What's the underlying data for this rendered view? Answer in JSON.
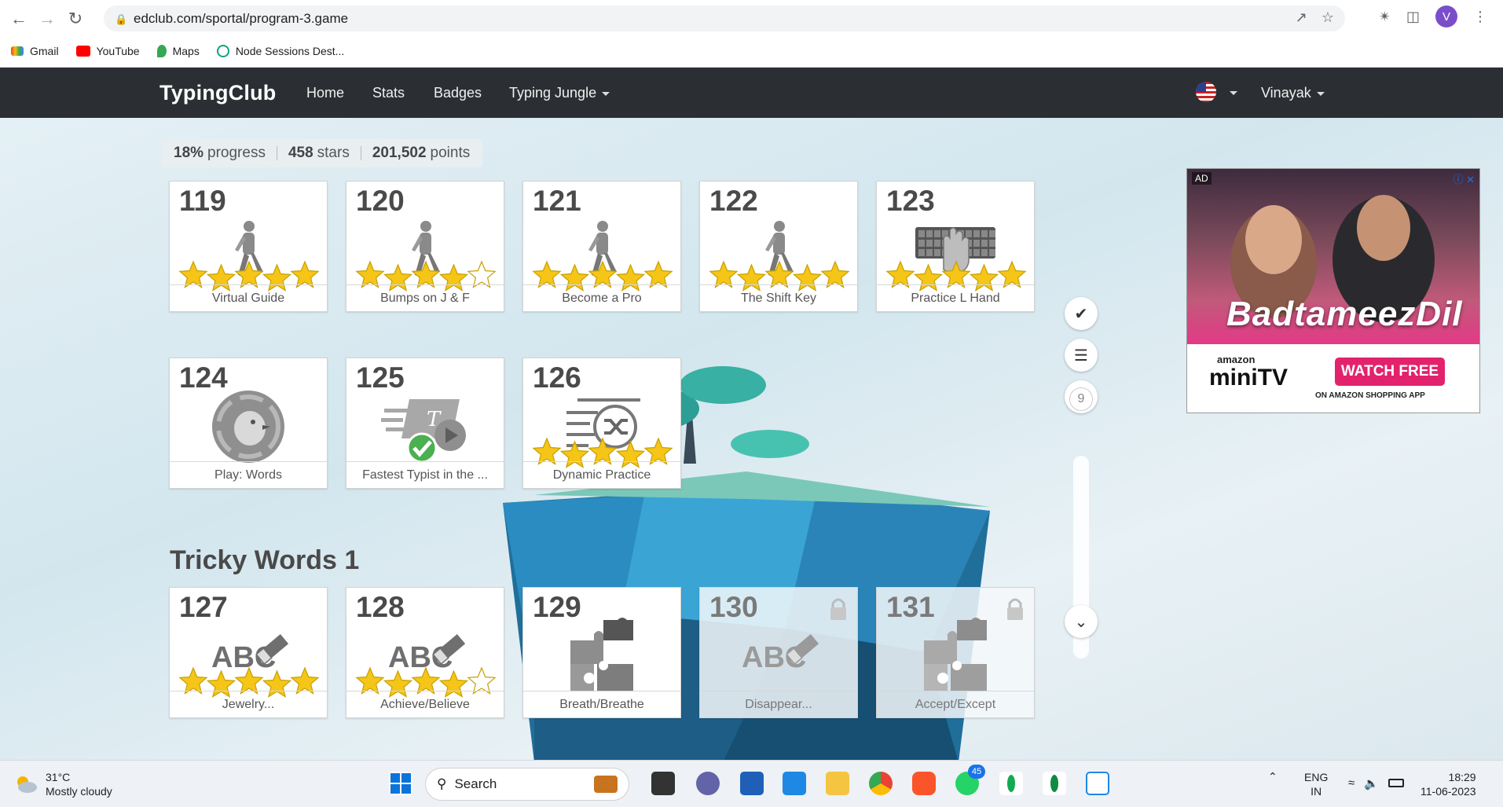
{
  "browser": {
    "url": "edclub.com/sportal/program-3.game",
    "profile_initial": "V",
    "bookmarks": [
      "Gmail",
      "YouTube",
      "Maps",
      "Node Sessions Dest..."
    ]
  },
  "site": {
    "logo": "TypingClub",
    "nav": [
      "Home",
      "Stats",
      "Badges",
      "Typing Jungle"
    ],
    "user": "Vinayak"
  },
  "stats": {
    "progress_value": "18%",
    "progress_label": "progress",
    "stars_value": "458",
    "stars_label": "stars",
    "points_value": "201,502",
    "points_label": "points"
  },
  "lessons": [
    {
      "num": "119",
      "label": "Virtual Guide",
      "icon": "walking-person-icon",
      "stars": 5,
      "locked": false
    },
    {
      "num": "120",
      "label": "Bumps on J & F",
      "icon": "walking-person-icon",
      "stars": 4,
      "locked": false
    },
    {
      "num": "121",
      "label": "Become a Pro",
      "icon": "walking-person-icon",
      "stars": 5,
      "locked": false
    },
    {
      "num": "122",
      "label": "The Shift Key",
      "icon": "walking-person-icon",
      "stars": 5,
      "locked": false
    },
    {
      "num": "123",
      "label": "Practice L Hand",
      "icon": "keyboard-hand-icon",
      "stars": 5,
      "locked": false
    },
    {
      "num": "124",
      "label": "Play: Words",
      "icon": "game-chick-icon",
      "stars": 0,
      "locked": false
    },
    {
      "num": "125",
      "label": "Fastest Typist in the ...",
      "icon": "video-check-icon",
      "stars": 0,
      "locked": false
    },
    {
      "num": "126",
      "label": "Dynamic Practice",
      "icon": "shuffle-text-icon",
      "stars": 5,
      "locked": false
    }
  ],
  "section_title": "Tricky Words 1",
  "section_lessons": [
    {
      "num": "127",
      "label": "Jewelry...",
      "icon": "abc-eraser-icon",
      "stars": 5,
      "locked": false
    },
    {
      "num": "128",
      "label": "Achieve/Believe",
      "icon": "abc-eraser-icon",
      "stars": 4,
      "locked": false
    },
    {
      "num": "129",
      "label": "Breath/Breathe",
      "icon": "puzzle-icon",
      "stars": 0,
      "locked": false
    },
    {
      "num": "130",
      "label": "Disappear...",
      "icon": "abc-eraser-icon",
      "stars": 0,
      "locked": true
    },
    {
      "num": "131",
      "label": "Accept/Except",
      "icon": "puzzle-icon",
      "stars": 0,
      "locked": true
    }
  ],
  "side": {
    "level": "9"
  },
  "ad": {
    "badge": "AD",
    "title": "BadtameezDil",
    "brand_small": "amazon",
    "brand": "miniTV",
    "cta": "WATCH FREE",
    "sub": "ON AMAZON SHOPPING APP"
  },
  "taskbar": {
    "temp": "31°C",
    "weather": "Mostly cloudy",
    "search": "Search",
    "whatsapp_badge": "45",
    "lang1": "ENG",
    "lang2": "IN",
    "time": "18:29",
    "date": "11-06-2023"
  },
  "colors": {
    "nav_bg": "#2b2f33",
    "star": "#f5c518",
    "ad_cta": "#e3226d"
  }
}
